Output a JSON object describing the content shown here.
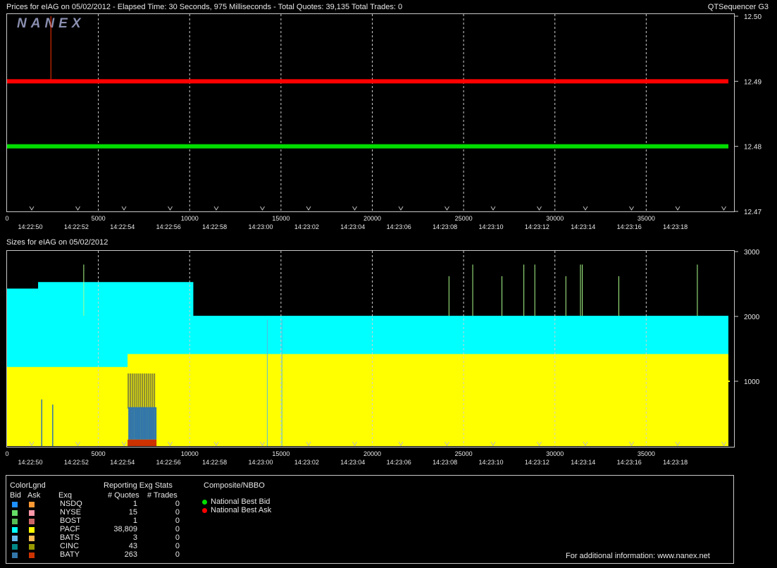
{
  "price_header": "Prices for  eIAG  on  05/02/2012  -  Elapsed Time: 30 Seconds, 975 Milliseconds  -  Total Quotes: 39,135  Total Trades: 0",
  "app_name": "QTSequencer G3",
  "logo_text": "NANEX",
  "size_header": "Sizes for  eIAG  on  05/02/2012",
  "chart_data": [
    {
      "type": "line",
      "panel": "prices",
      "x_unit": "milliseconds",
      "xlim": [
        0,
        39500
      ],
      "ylim": [
        12.47,
        12.5
      ],
      "x_ticks": [
        0,
        5000,
        10000,
        15000,
        20000,
        25000,
        30000,
        35000
      ],
      "time_ticks": [
        "14:22:50",
        "14:22:52",
        "14:22:54",
        "14:22:56",
        "14:22:58",
        "14:23:00",
        "14:23:02",
        "14:23:04",
        "14:23:06",
        "14:23:08",
        "14:23:10",
        "14:23:12",
        "14:23:14",
        "14:23:16",
        "14:23:18"
      ],
      "y_ticks": [
        "12.50",
        "12.49",
        "12.48",
        "12.47"
      ],
      "series": [
        {
          "name": "National Best Ask",
          "color": "#ff0000",
          "x": [
            0,
            39500
          ],
          "y": [
            12.49,
            12.49
          ]
        },
        {
          "name": "National Best Bid",
          "color": "#00dd00",
          "x": [
            0,
            39500
          ],
          "y": [
            12.48,
            12.48
          ]
        }
      ],
      "annotations": [
        {
          "type": "spike",
          "x": 2400,
          "from": 12.49,
          "to": 12.5,
          "color": "#ff3300"
        }
      ]
    },
    {
      "type": "area",
      "panel": "sizes",
      "x_unit": "milliseconds",
      "xlim": [
        0,
        39500
      ],
      "ylim": [
        0,
        3000
      ],
      "x_ticks": [
        0,
        5000,
        10000,
        15000,
        20000,
        25000,
        30000,
        35000
      ],
      "time_ticks": [
        "14:22:50",
        "14:22:52",
        "14:22:54",
        "14:22:56",
        "14:22:58",
        "14:23:00",
        "14:23:02",
        "14:23:04",
        "14:23:06",
        "14:23:08",
        "14:23:10",
        "14:23:12",
        "14:23:14",
        "14:23:16",
        "14:23:18"
      ],
      "y_ticks": [
        "3000",
        "2000",
        "1000"
      ],
      "series": [
        {
          "name": "Ask size (PACF)",
          "color": "#00ffff",
          "steps": [
            [
              0,
              2430
            ],
            [
              1700,
              2530
            ],
            [
              10200,
              2010
            ],
            [
              39500,
              2010
            ]
          ]
        },
        {
          "name": "Bid size (PACF)",
          "color": "#ffff00",
          "steps": [
            [
              0,
              1220
            ],
            [
              6600,
              1420
            ],
            [
              39500,
              1420
            ]
          ]
        }
      ],
      "spikes_top": [
        {
          "x": 4200,
          "value": 2800
        },
        {
          "x": 24200,
          "value": 2620
        },
        {
          "x": 25500,
          "value": 2800
        },
        {
          "x": 27100,
          "value": 2620
        },
        {
          "x": 28300,
          "value": 2800
        },
        {
          "x": 28900,
          "value": 2800
        },
        {
          "x": 30600,
          "value": 2620
        },
        {
          "x": 31400,
          "value": 2800
        },
        {
          "x": 31500,
          "value": 2800
        },
        {
          "x": 33500,
          "value": 2620
        },
        {
          "x": 37800,
          "value": 2800
        }
      ],
      "spikes_bottom": [
        {
          "x": 1900,
          "value": 720
        },
        {
          "x": 2500,
          "value": 640
        }
      ],
      "cluster": {
        "x_start": 6600,
        "x_end": 8100,
        "top": 1120,
        "mid": 600,
        "low": 100
      }
    }
  ],
  "legend": {
    "title": "ColorLgnd",
    "bid_label": "Bid",
    "ask_label": "Ask",
    "exq_label": "Exq",
    "stats_title": "Reporting Exg Stats",
    "quotes_label": "# Quotes",
    "trades_label": "# Trades",
    "composite_title": "Composite/NBBO",
    "nbb_label": "National Best Bid",
    "nba_label": "National Best Ask",
    "nbb_color": "#00dd00",
    "nba_color": "#ff0000",
    "rows": [
      {
        "exch": "NSDQ",
        "quotes": "1",
        "trades": "0",
        "bid_color": "#1e90ff",
        "ask_color": "#ff9933"
      },
      {
        "exch": "NYSE",
        "quotes": "15",
        "trades": "0",
        "bid_color": "#66dd66",
        "ask_color": "#ff99aa"
      },
      {
        "exch": "BOST",
        "quotes": "1",
        "trades": "0",
        "bid_color": "#55bb55",
        "ask_color": "#cc6666"
      },
      {
        "exch": "PACF",
        "quotes": "38,809",
        "trades": "0",
        "bid_color": "#00ffff",
        "ask_color": "#ffff00"
      },
      {
        "exch": "BATS",
        "quotes": "3",
        "trades": "0",
        "bid_color": "#66bbee",
        "ask_color": "#ffbb55"
      },
      {
        "exch": "CINC",
        "quotes": "43",
        "trades": "0",
        "bid_color": "#008888",
        "ask_color": "#999900"
      },
      {
        "exch": "BATY",
        "quotes": "263",
        "trades": "0",
        "bid_color": "#3377aa",
        "ask_color": "#cc3300"
      }
    ],
    "footer": "For additional information: www.nanex.net"
  }
}
